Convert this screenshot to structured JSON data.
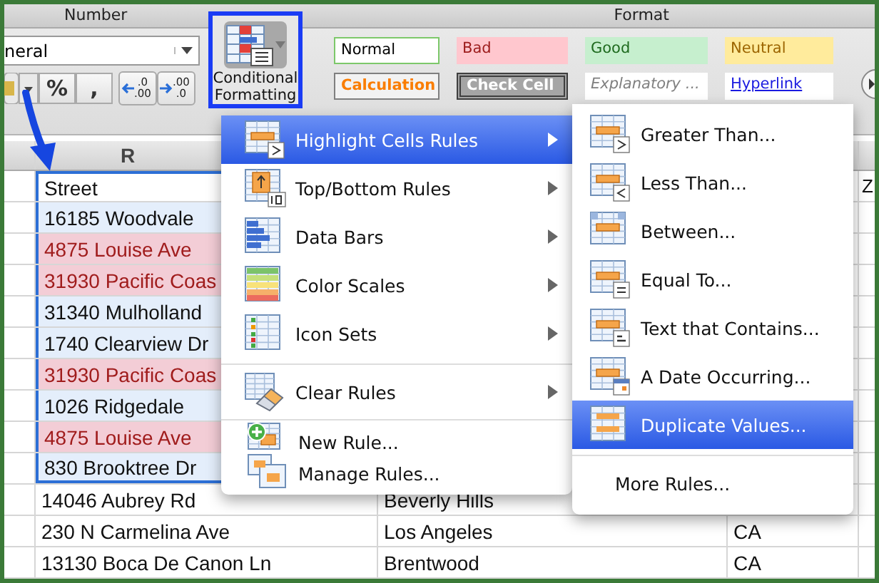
{
  "ribbon": {
    "groups": [
      {
        "title": "Number"
      },
      {
        "title": "Format"
      }
    ],
    "number_format": {
      "value": "neral"
    },
    "number_buttons": [
      {
        "label": "%"
      },
      {
        "label": ","
      }
    ],
    "decimal_buttons": [
      {
        "kind": "decrease",
        "top": ".0",
        "bottom": ".00"
      },
      {
        "kind": "increase",
        "top": ".00",
        "bottom": ".0"
      }
    ],
    "conditional_formatting": {
      "label": "Conditional Formatting",
      "selected": true
    },
    "styles": [
      {
        "label": "Normal",
        "kind": "normal"
      },
      {
        "label": "Bad",
        "kind": "bad"
      },
      {
        "label": "Good",
        "kind": "good"
      },
      {
        "label": "Neutral",
        "kind": "neutral"
      },
      {
        "label": "Calculation",
        "kind": "calculation"
      },
      {
        "label": "Check Cell",
        "kind": "check"
      },
      {
        "label": "Explanatory ...",
        "kind": "explanatory"
      },
      {
        "label": "Hyperlink",
        "kind": "hyperlink"
      }
    ]
  },
  "sheet": {
    "street_column_header": "R",
    "rows": [
      {
        "street": "Street",
        "zip": "Z",
        "selected": true,
        "duplicate": false
      },
      {
        "street": "16185 Woodvale",
        "selected": true,
        "duplicate": false
      },
      {
        "street": "4875 Louise Ave",
        "selected": true,
        "duplicate": true
      },
      {
        "street": "31930 Pacific Coas",
        "selected": true,
        "duplicate": true
      },
      {
        "street": "31340 Mulholland",
        "selected": true,
        "duplicate": false
      },
      {
        "street": "1740 Clearview Dr",
        "selected": true,
        "duplicate": false
      },
      {
        "street": "31930 Pacific Coas",
        "selected": true,
        "duplicate": true
      },
      {
        "street": "1026 Ridgedale",
        "selected": true,
        "duplicate": false
      },
      {
        "street": "4875 Louise Ave",
        "selected": true,
        "duplicate": true
      },
      {
        "street": "830 Brooktree Dr",
        "selected": true,
        "duplicate": false
      },
      {
        "street": "14046 Aubrey Rd",
        "city": "Beverly Hills",
        "selected": false,
        "duplicate": false
      },
      {
        "street": "230 N Carmelina Ave",
        "city": "Los Angeles",
        "state": "CA",
        "selected": false,
        "duplicate": false
      },
      {
        "street": "13130 Boca De Canon Ln",
        "city": "Brentwood",
        "state": "CA",
        "selected": false,
        "duplicate": false
      }
    ]
  },
  "menu": {
    "items": [
      {
        "label": "Highlight Cells Rules",
        "kind": "highlight",
        "selected": true,
        "has_submenu": true
      },
      {
        "label": "Top/Bottom Rules",
        "kind": "topbottom",
        "selected": false,
        "has_submenu": true
      },
      {
        "label": "Data Bars",
        "kind": "databars",
        "selected": false,
        "has_submenu": true
      },
      {
        "label": "Color Scales",
        "kind": "colorscales",
        "selected": false,
        "has_submenu": true
      },
      {
        "label": "Icon Sets",
        "kind": "iconsets",
        "selected": false,
        "has_submenu": true
      },
      {
        "kind": "separator"
      },
      {
        "label": "Clear Rules",
        "kind": "clear",
        "selected": false,
        "has_submenu": true
      },
      {
        "kind": "separator"
      },
      {
        "label": "New Rule...",
        "kind": "new",
        "selected": false,
        "has_submenu": false
      },
      {
        "label": "Manage Rules...",
        "kind": "manage",
        "selected": false,
        "has_submenu": false
      }
    ]
  },
  "submenu": {
    "items": [
      {
        "label": "Greater Than...",
        "kind": "greater",
        "selected": false
      },
      {
        "label": "Less Than...",
        "kind": "less",
        "selected": false
      },
      {
        "label": "Between...",
        "kind": "between",
        "selected": false
      },
      {
        "label": "Equal To...",
        "kind": "equal",
        "selected": false
      },
      {
        "label": "Text that Contains...",
        "kind": "text",
        "selected": false
      },
      {
        "label": "A Date Occurring...",
        "kind": "date",
        "selected": false
      },
      {
        "label": "Duplicate Values...",
        "kind": "duplicate",
        "selected": true
      },
      {
        "kind": "separator"
      },
      {
        "label": "More Rules...",
        "kind": "plain",
        "selected": false
      }
    ]
  }
}
